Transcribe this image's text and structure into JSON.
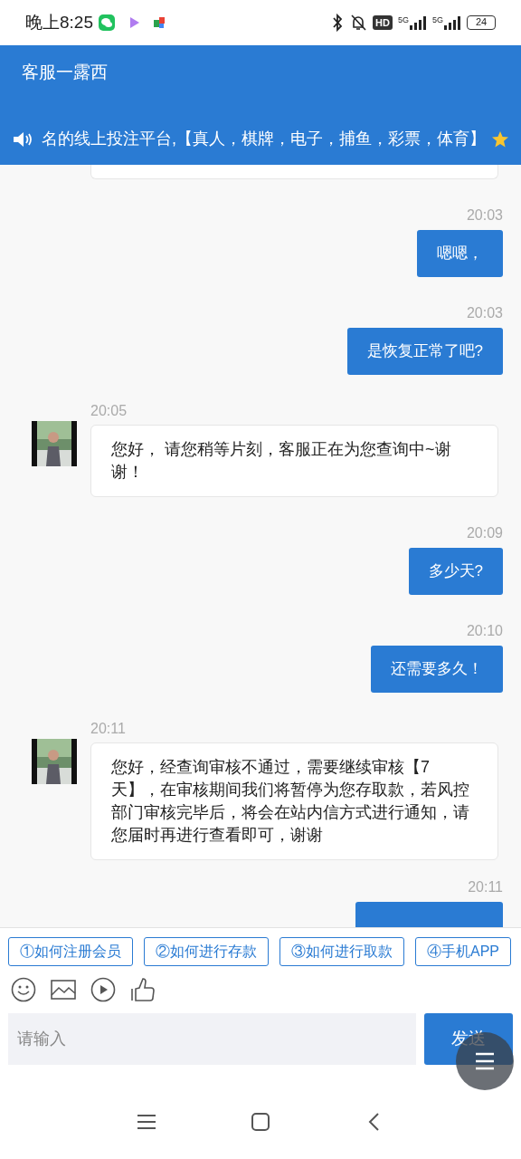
{
  "status_bar": {
    "time": "晚上8:25",
    "hd": "HD",
    "networks": [
      "5G",
      "5G"
    ],
    "battery": "24"
  },
  "header": {
    "title": "客服一露西",
    "marquee": "名的线上投注平台,【真人，棋牌，电子，捕鱼，彩票，体育】"
  },
  "messages": [
    {
      "outgoing": false,
      "kind": "clipped"
    },
    {
      "outgoing": true,
      "time": "20:03",
      "text": "嗯嗯，"
    },
    {
      "outgoing": true,
      "time": "20:03",
      "text": "是恢复正常了吧?"
    },
    {
      "outgoing": false,
      "time": "20:05",
      "text": "您好， 请您稍等片刻，客服正在为您查询中~谢谢！"
    },
    {
      "outgoing": true,
      "time": "20:09",
      "text": "多少天?"
    },
    {
      "outgoing": true,
      "time": "20:10",
      "text": "还需要多久！"
    },
    {
      "outgoing": false,
      "time": "20:11",
      "text": "您好，经查询审核不通过，需要继续审核【7天】，在审核期间我们将暂停为您存取款，若风控部门审核完毕后，将会在站内信方式进行通知，请您届时再进行查看即可，谢谢"
    },
    {
      "outgoing": true,
      "time": "20:11",
      "kind": "clipped"
    }
  ],
  "quick_replies": [
    "①如何注册会员",
    "②如何进行存款",
    "③如何进行取款",
    "④手机APP"
  ],
  "composer": {
    "placeholder": "请输入",
    "send": "发送"
  }
}
